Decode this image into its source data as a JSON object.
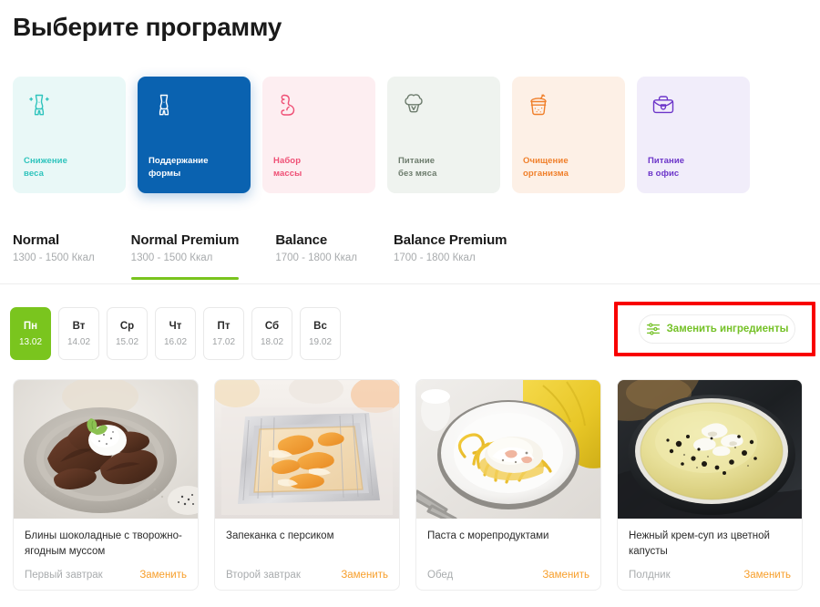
{
  "page_title": "Выберите программу",
  "colors": {
    "accent_green": "#7ac51e",
    "brand_blue": "#0a62b0",
    "replace_orange": "#f79f2c",
    "annotation_red": "#f80000"
  },
  "programs": [
    {
      "label_line1": "Снижение",
      "label_line2": "веса",
      "icon": "body-slim-icon",
      "bg": "#e9f8f7",
      "fg": "#2fc4bd",
      "selected": false
    },
    {
      "label_line1": "Поддержание",
      "label_line2": "формы",
      "icon": "body-shape-icon",
      "bg": "#0a62b0",
      "fg": "#ffffff",
      "selected": true
    },
    {
      "label_line1": "Набор",
      "label_line2": "массы",
      "icon": "muscle-arm-icon",
      "bg": "#fdeef1",
      "fg": "#ef4f75",
      "selected": false
    },
    {
      "label_line1": "Питание",
      "label_line2": "без мяса",
      "icon": "broccoli-icon",
      "bg": "#eff3ef",
      "fg": "#6d7c6d",
      "selected": false
    },
    {
      "label_line1": "Очищение",
      "label_line2": "организма",
      "icon": "smoothie-cup-icon",
      "bg": "#fdf0e6",
      "fg": "#f07f2a",
      "selected": false
    },
    {
      "label_line1": "Питание",
      "label_line2": "в офис",
      "icon": "briefcase-icon",
      "bg": "#f1edfa",
      "fg": "#6c35c9",
      "selected": false
    }
  ],
  "tabs": [
    {
      "name": "Normal",
      "kcal": "1300 - 1500 Ккал",
      "active": false
    },
    {
      "name": "Normal Premium",
      "kcal": "1300 - 1500 Ккал",
      "active": true
    },
    {
      "name": "Balance",
      "kcal": "1700 - 1800 Ккал",
      "active": false
    },
    {
      "name": "Balance Premium",
      "kcal": "1700 - 1800 Ккал",
      "active": false
    }
  ],
  "days": [
    {
      "name": "Пн",
      "date": "13.02",
      "active": true
    },
    {
      "name": "Вт",
      "date": "14.02",
      "active": false
    },
    {
      "name": "Ср",
      "date": "15.02",
      "active": false
    },
    {
      "name": "Чт",
      "date": "16.02",
      "active": false
    },
    {
      "name": "Пт",
      "date": "17.02",
      "active": false
    },
    {
      "name": "Сб",
      "date": "18.02",
      "active": false
    },
    {
      "name": "Вс",
      "date": "19.02",
      "active": false
    }
  ],
  "replace_ingredients_button": {
    "label": "Заменить ингредиенты",
    "icon": "sliders-icon",
    "highlighted": true
  },
  "meals": [
    {
      "title": "Блины шоколадные с творожно-ягодным муссом",
      "type": "Первый завтрак",
      "replace_label": "Заменить",
      "photo": "chocolate-pancakes-photo"
    },
    {
      "title": "Запеканка с персиком",
      "type": "Второй завтрак",
      "replace_label": "Заменить",
      "photo": "peach-casserole-photo"
    },
    {
      "title": "Паста с морепродуктами",
      "type": "Обед",
      "replace_label": "Заменить",
      "photo": "seafood-pasta-photo"
    },
    {
      "title": "Нежный крем-суп из цветной капусты",
      "type": "Полдник",
      "replace_label": "Заменить",
      "photo": "cauliflower-cream-soup-photo"
    }
  ]
}
